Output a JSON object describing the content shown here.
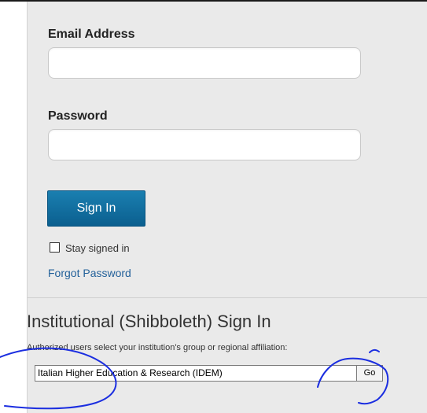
{
  "form": {
    "email_label": "Email Address",
    "email_value": "",
    "password_label": "Password",
    "password_value": "",
    "signin_label": "Sign In",
    "stay_signed_in_label": "Stay signed in",
    "stay_signed_in_checked": false,
    "forgot_password_label": "Forgot Password"
  },
  "institutional": {
    "title": "Institutional (Shibboleth) Sign In",
    "description": "Authorized users select your institution's group or regional affiliation:",
    "selected_option": "Italian Higher Education & Research (IDEM)",
    "go_label": "Go"
  },
  "colors": {
    "signin_button": "#0b6a9e",
    "link": "#23619a",
    "annotation_ink": "#1b2ee0",
    "panel_background": "#eaeaea"
  }
}
